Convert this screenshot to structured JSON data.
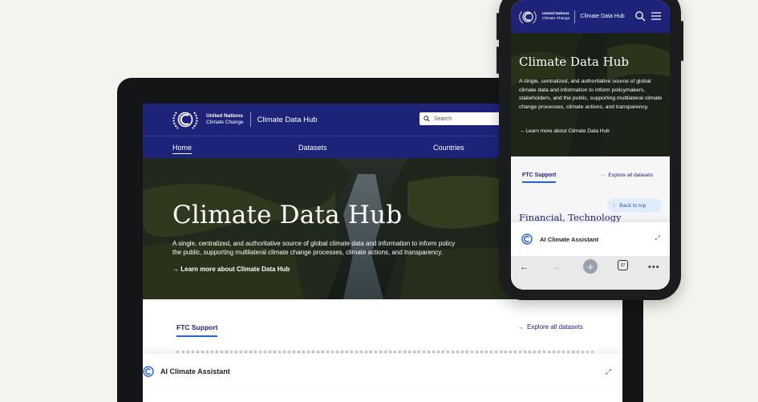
{
  "brand": {
    "org_line1": "United Nations",
    "org_line2": "Climate Change",
    "site_name": "Climate Data Hub"
  },
  "laptop": {
    "search_placeholder": "Search",
    "nav": [
      "Home",
      "Datasets",
      "Countries"
    ],
    "hero": {
      "title": "Climate Data Hub",
      "description_line1": "A single, centralized, and authoritative source of global climate data and information to inform policy",
      "description_line2": "the public, supporting multilateral climate change processes, climate actions, and transparency.",
      "learn_more": "Learn more about Climate Data Hub"
    },
    "section_tab": "FTC Support",
    "explore_link": "Explore all datasets",
    "assistant_label": "AI Climate Assistant"
  },
  "phone": {
    "hero": {
      "title": "Climate Data Hub",
      "description": "A single, centralized, and authoritative source of global climate data and information to inform policymakers, stakeholders, and the public, supporting multilateral climate change processes, climate actions, and transparency.",
      "learn_more": "Learn more about Climate Data Hub"
    },
    "section_tab": "FTC Support",
    "explore_link": "Explore all datasets",
    "back_to_top": "Back to top",
    "section_heading": "Financial, Technology",
    "assistant_label": "AI Climate Assistant",
    "browser": {
      "tab_count": "37"
    }
  },
  "colors": {
    "navy": "#1e237a",
    "accent_blue": "#2563d8",
    "page_background": "#f4f4ee"
  },
  "icons": [
    "un-emblem-icon",
    "search-icon",
    "menu-icon",
    "arrow-right-icon",
    "arrow-up-icon",
    "assistant-icon",
    "expand-icon",
    "back-icon",
    "forward-icon",
    "plus-icon",
    "tabs-icon",
    "more-icon"
  ]
}
